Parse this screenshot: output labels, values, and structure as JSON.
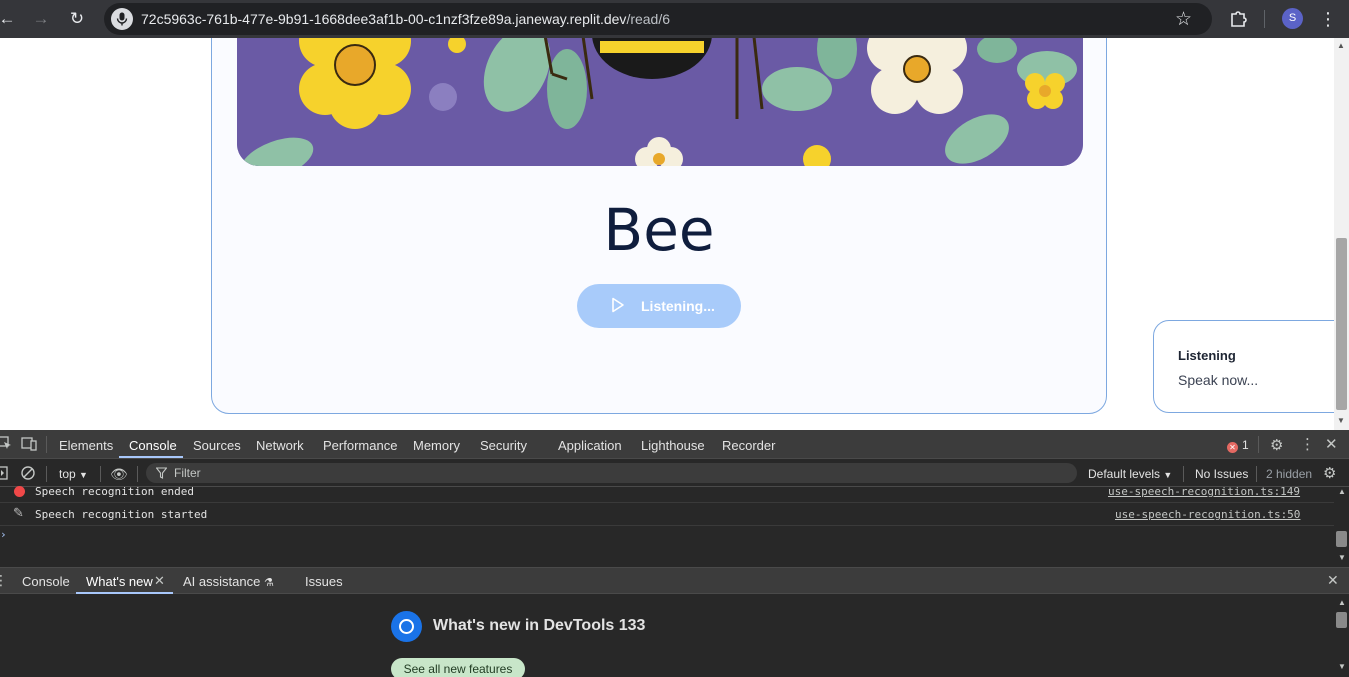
{
  "browser": {
    "url_host": "72c5963c-761b-477e-9b91-1668dee3af1b-00-c1nzf3fze89a.janeway.replit.dev",
    "url_path": "/read/6",
    "profile_initial": "S"
  },
  "page": {
    "word": "Bee",
    "listen_button_label": "Listening...",
    "toast": {
      "title": "Listening",
      "message": "Speak now..."
    }
  },
  "devtools": {
    "tabs": [
      "Elements",
      "Console",
      "Sources",
      "Network",
      "Performance",
      "Memory",
      "Security",
      "Application",
      "Lighthouse",
      "Recorder"
    ],
    "active_tab": "Console",
    "error_count": "1",
    "context": "top",
    "filter_placeholder": "Filter",
    "default_levels": "Default levels",
    "no_issues": "No Issues",
    "hidden_count": "2 hidden",
    "logs": [
      {
        "type": "error",
        "message": "Speech recognition ended",
        "source": "use-speech-recognition.ts:149"
      },
      {
        "type": "log",
        "message": "Speech recognition started",
        "source": "use-speech-recognition.ts:50"
      }
    ],
    "drawer_tabs": [
      "Console",
      "What's new",
      "AI assistance",
      "Issues"
    ],
    "drawer_active": "What's new",
    "whats_new_title": "What's new in DevTools 133",
    "see_all_label": "See all new features"
  },
  "colors": {
    "accent": "#a8cbfa",
    "card_border": "#7da8e0",
    "word_color": "#0f1d3d",
    "devtools_bg": "#282828"
  }
}
